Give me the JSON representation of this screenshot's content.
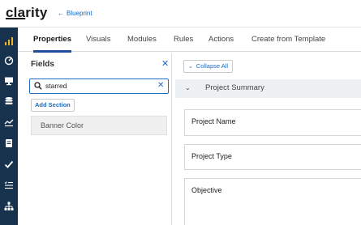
{
  "app": {
    "logo_text_underlined": "cla",
    "logo_text_rest": "rity",
    "back_link_arrow": "←",
    "back_link_label": "Blueprint"
  },
  "rail": {
    "background_color": "#17324d",
    "icons": [
      "bar-chart-icon",
      "dashboard-gauge-icon",
      "monitor-icon",
      "database-stack-icon",
      "line-chart-icon",
      "document-icon",
      "checkmark-icon",
      "checklist-icon",
      "hierarchy-icon"
    ]
  },
  "tabs": [
    {
      "label": "Properties",
      "active": true
    },
    {
      "label": "Visuals",
      "active": false
    },
    {
      "label": "Modules",
      "active": false
    },
    {
      "label": "Rules",
      "active": false
    },
    {
      "label": "Actions",
      "active": false
    },
    {
      "label": "Create from Template",
      "active": false
    }
  ],
  "fields_panel": {
    "title": "Fields",
    "close_glyph": "✕",
    "search": {
      "value": "starred",
      "clear_glyph": "✕"
    },
    "add_section_label": "Add Section",
    "items": [
      {
        "label": "Banner Color"
      }
    ]
  },
  "content": {
    "collapse_all_label": "Collapse All",
    "section": {
      "title": "Project Summary",
      "chevron_glyph": "⌄"
    },
    "fields": [
      {
        "label": "Project Name"
      },
      {
        "label": "Project Type"
      },
      {
        "label": "Objective"
      }
    ]
  },
  "colors": {
    "accent": "#1e6bc2",
    "active_tab_underline": "#1e4f9a",
    "section_bar": "#eef1f4"
  }
}
